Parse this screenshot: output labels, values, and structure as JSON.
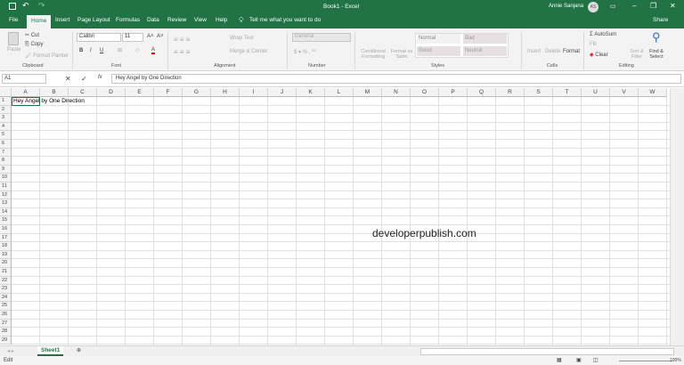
{
  "title": {
    "doc": "Book1 - Excel",
    "user": "Annie Sanjana",
    "initials": "AS",
    "share": "Share"
  },
  "tabs": [
    "File",
    "Home",
    "Insert",
    "Page Layout",
    "Formulas",
    "Data",
    "Review",
    "View",
    "Help"
  ],
  "tell_me": "Tell me what you want to do",
  "ribbon": {
    "clipboard": {
      "paste": "Paste",
      "cut": "Cut",
      "copy": "Copy",
      "format_painter": "Format Painter",
      "label": "Clipboard"
    },
    "font": {
      "name": "Calibri",
      "size": "11",
      "label": "Font",
      "bold": "B",
      "italic": "I",
      "underline": "U"
    },
    "alignment": {
      "wrap": "Wrap Text",
      "merge": "Merge & Center",
      "label": "Alignment"
    },
    "number": {
      "format": "General",
      "label": "Number"
    },
    "styles": {
      "conditional": "Conditional Formatting",
      "format_table": "Format as Table",
      "normal": "Normal",
      "bad": "Bad",
      "good": "Good",
      "neutral": "Neutral",
      "label": "Styles"
    },
    "cells": {
      "insert": "Insert",
      "delete": "Delete",
      "format": "Format",
      "label": "Cells"
    },
    "editing": {
      "autosum": "AutoSum",
      "fill": "Fill",
      "clear": "Clear",
      "sort": "Sort & Filter",
      "find": "Find & Select",
      "label": "Editing"
    }
  },
  "formula_bar": {
    "name_box": "A1",
    "content": "Hey Angel by One Direction"
  },
  "columns": [
    "A",
    "B",
    "C",
    "D",
    "E",
    "F",
    "G",
    "H",
    "I",
    "J",
    "K",
    "L",
    "M",
    "N",
    "O",
    "P",
    "Q",
    "R",
    "S",
    "T",
    "U",
    "V",
    "W"
  ],
  "rows": [
    1,
    2,
    3,
    4,
    5,
    6,
    7,
    8,
    9,
    10,
    11,
    12,
    13,
    14,
    15,
    16,
    17,
    18,
    19,
    20,
    21,
    22,
    23,
    24,
    25,
    26,
    27,
    28,
    29
  ],
  "cells": {
    "A1": "Hey Angel by One Direction"
  },
  "watermark": "developerpublish.com",
  "sheet_tab": "Sheet1",
  "status": {
    "mode": "Edit",
    "zoom": "100%"
  },
  "colors": {
    "brand": "#217346"
  }
}
